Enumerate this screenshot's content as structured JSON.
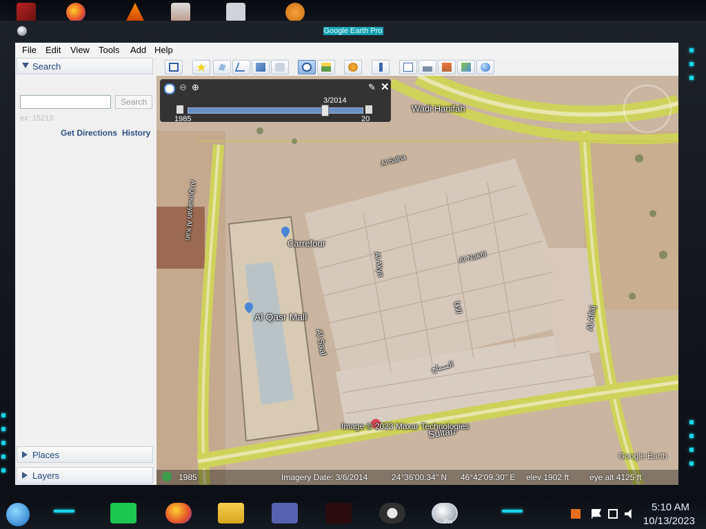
{
  "window": {
    "title": "Google Earth Pro"
  },
  "menu": {
    "items": [
      "File",
      "Edit",
      "View",
      "Tools",
      "Add",
      "Help"
    ]
  },
  "search": {
    "header": "Search",
    "placeholder": "",
    "button_label": "Search",
    "hint": "ex: 15213",
    "get_directions": "Get Directions",
    "history": "History"
  },
  "panels": {
    "places": "Places",
    "layers": "Layers"
  },
  "toolbar": {
    "icons": [
      "sidebar-toggle-icon",
      "placemark-icon",
      "polygon-icon",
      "path-icon",
      "image-overlay-icon",
      "record-tour-icon",
      "historical-imagery-icon",
      "sunlight-icon",
      "planets-icon",
      "ruler-icon",
      "email-icon",
      "print-icon",
      "save-image-icon",
      "view-in-maps-icon",
      "earth-icon"
    ],
    "active": [
      "historical-imagery-icon"
    ]
  },
  "time_slider": {
    "current_date": "3/2014",
    "start_year": "1985",
    "end_year": "20",
    "position": 0.78
  },
  "map": {
    "labels": {
      "carrefour": "Carrefour",
      "al_qasr_mall": "Al Qasr Mall",
      "wadi_hanifah": "Wadi Hanifah",
      "al_saal": "Al Saal",
      "al_afiaj": "Al Aflaj",
      "al_akya": "Al Akya",
      "al_nakhil": "Al Nakhl",
      "al_salha": "Al Salha",
      "sultan": "Sultan",
      "qassim": "Al Quwaiyah Al Kari",
      "arabic_1": "السماح",
      "arabic_2": "الاقا",
      "copyright": "Image © 2023 Maxar Technologies",
      "google_earth": "Google Earth",
      "bottom_year": "1985"
    }
  },
  "status": {
    "imagery_date": "Imagery Date: 3/6/2014",
    "lat": "24°36'00.34\" N",
    "lon": "46°42'09.30\" E",
    "elev": "elev  1902 ft",
    "eye_alt": "eye alt   4125 ft"
  },
  "taskbar": {
    "apps": [
      "spotify-icon",
      "firefox-icon",
      "file-explorer-icon",
      "app-card-icon",
      "game-icon",
      "obs-icon",
      "google-earth-pro-icon"
    ],
    "pro_label": "Pro",
    "time": "5:10 AM",
    "date": "10/13/2023"
  },
  "colors": {
    "accent": "#19d6e8",
    "menu_text": "#23497c",
    "road": "#cfd25a"
  }
}
